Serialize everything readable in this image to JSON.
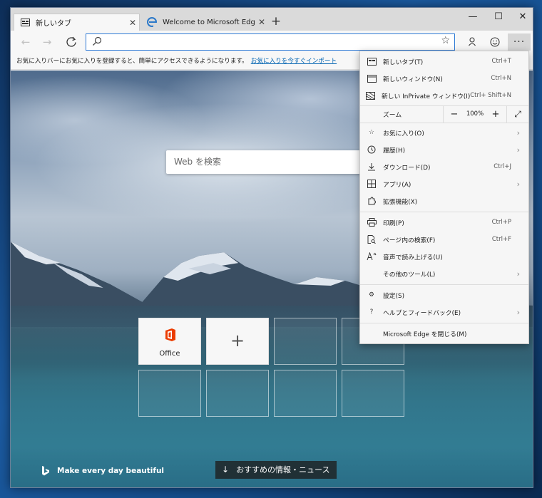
{
  "window": {
    "tabs": [
      {
        "title": "新しいタブ",
        "active": true
      },
      {
        "title": "Welcome to Microsoft Edge Dev",
        "active": false
      }
    ],
    "new_tab_symbol": "+",
    "controls": {
      "minimize": "—",
      "maximize": "☐",
      "close": "✕"
    }
  },
  "toolbar": {
    "address_value": "",
    "icons": [
      "back-icon",
      "forward-icon",
      "refresh-icon",
      "favorite-star-icon",
      "profile-icon",
      "feedback-icon",
      "more-icon"
    ]
  },
  "favbar": {
    "text": "お気に入りバーにお気に入りを登録すると、簡単にアクセスできるようになります。",
    "link": "お気に入りを今すぐインポート"
  },
  "page": {
    "search_placeholder": "Web を検索",
    "tiles": [
      {
        "label": "Office",
        "type": "office"
      },
      {
        "label": "",
        "type": "add",
        "symbol": "+"
      },
      {
        "label": "",
        "type": "empty"
      },
      {
        "label": "",
        "type": "empty"
      },
      {
        "label": "",
        "type": "empty"
      },
      {
        "label": "",
        "type": "empty"
      },
      {
        "label": "",
        "type": "empty"
      },
      {
        "label": "",
        "type": "empty"
      }
    ],
    "bing_text": "Make every day beautiful",
    "news_button": "おすすめの情報・ニュース"
  },
  "menu": {
    "new_tab": {
      "label": "新しいタブ(T)",
      "shortcut": "Ctrl+T"
    },
    "new_window": {
      "label": "新しいウィンドウ(N)",
      "shortcut": "Ctrl+N"
    },
    "new_inprivate": {
      "label": "新しい InPrivate ウィンドウ(I)",
      "shortcut": "Ctrl+ Shift+N"
    },
    "zoom": {
      "label": "ズーム",
      "minus": "−",
      "value": "100%",
      "plus": "+"
    },
    "favorites": {
      "label": "お気に入り(O)"
    },
    "history": {
      "label": "履歴(H)"
    },
    "downloads": {
      "label": "ダウンロード(D)",
      "shortcut": "Ctrl+J"
    },
    "apps": {
      "label": "アプリ(A)"
    },
    "extensions": {
      "label": "拡張機能(X)"
    },
    "print": {
      "label": "印刷(P)",
      "shortcut": "Ctrl+P"
    },
    "find": {
      "label": "ページ内の検索(F)",
      "shortcut": "Ctrl+F"
    },
    "read_aloud": {
      "label": "音声で読み上げる(U)"
    },
    "more_tools": {
      "label": "その他のツール(L)"
    },
    "settings": {
      "label": "設定(S)"
    },
    "help": {
      "label": "ヘルプとフィードバック(E)"
    },
    "close_edge": {
      "label": "Microsoft Edge を閉じる(M)"
    }
  },
  "colors": {
    "accent": "#2f7ad6",
    "office": "#eb3c00",
    "link": "#0063b1"
  }
}
